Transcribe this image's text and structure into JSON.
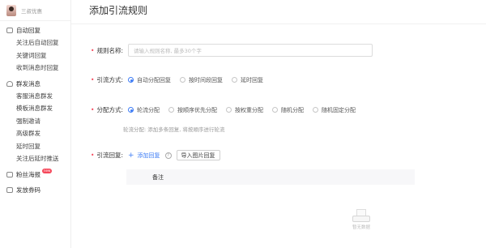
{
  "brand": {
    "name": "三叔优惠"
  },
  "sidebar": {
    "groups": [
      {
        "label": "自动回复",
        "icon": "chat-icon"
      },
      {
        "label": "群发消息",
        "icon": "person-icon"
      },
      {
        "label": "粉丝海报",
        "icon": "poster-icon",
        "badge": "new"
      },
      {
        "label": "发放券码",
        "icon": "coupon-icon"
      }
    ],
    "auto_reply_items": [
      "关注后自动回复",
      "关键词回复",
      "收到消息时回复"
    ],
    "mass_items": [
      "客服消息群发",
      "模板消息群发",
      "强制邀请",
      "高级群发",
      "延时回复",
      "关注后延时推送"
    ]
  },
  "page": {
    "title": "添加引流规则"
  },
  "form": {
    "rule_name": {
      "label": "规则名称:",
      "placeholder": "请输入规则名称, 最多30个字",
      "value": ""
    },
    "drain_method": {
      "label": "引流方式:",
      "options": [
        "自动分配回复",
        "按时间段回复",
        "延时回复"
      ],
      "selected": "自动分配回复"
    },
    "assign_method": {
      "label": "分配方式:",
      "options": [
        "轮流分配",
        "按顺序优先分配",
        "按权重分配",
        "随机分配",
        "随机固定分配"
      ],
      "selected": "轮流分配",
      "hint": "轮流分配: 添加多条回复, 将按顺序进行轮流"
    },
    "drain_reply": {
      "label": "引流回复:",
      "add_label": "添加回复",
      "import_label": "导入图片回复"
    }
  },
  "table": {
    "columns": [
      "备注"
    ],
    "empty_text": "暂无数据"
  },
  "colors": {
    "accent": "#3d7cf5",
    "required": "#f5475a"
  }
}
